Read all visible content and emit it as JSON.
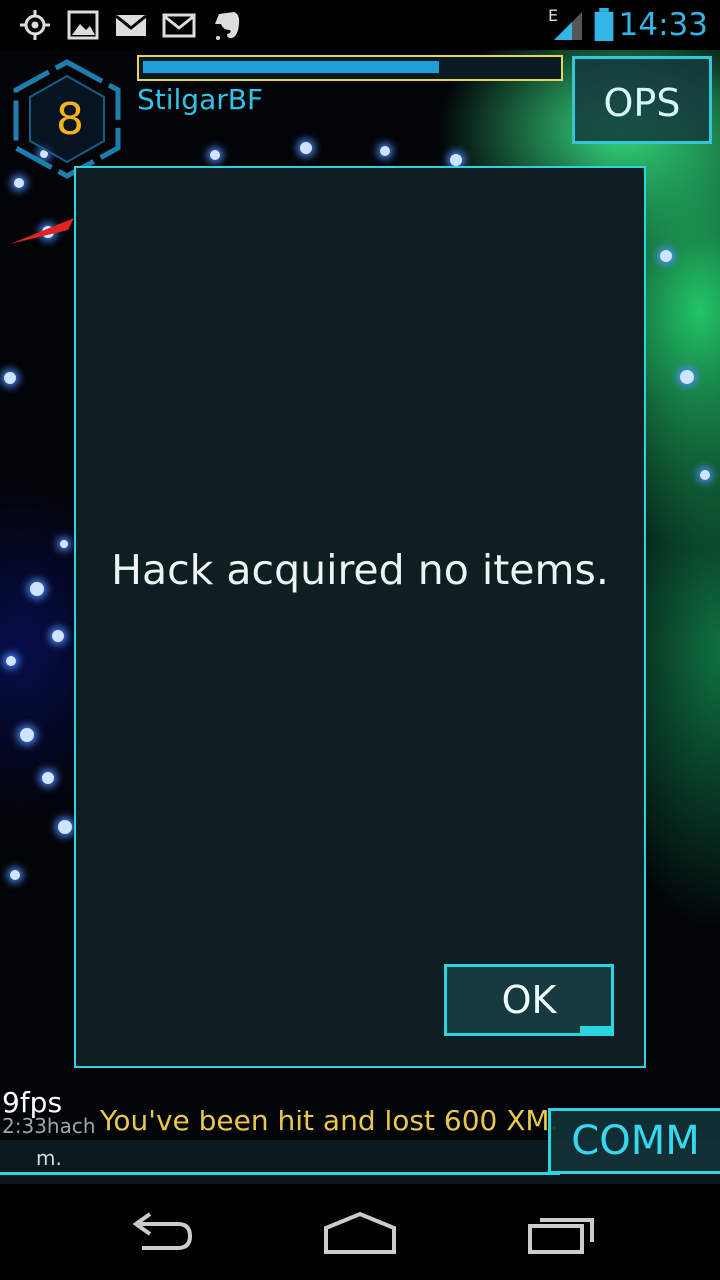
{
  "status_bar": {
    "time": "14:33",
    "network_type": "E",
    "icons": [
      "gps-icon",
      "gallery-icon",
      "gmail-icon",
      "gmail-icon",
      "evernote-icon",
      "signal-icon",
      "battery-icon"
    ]
  },
  "hud": {
    "level": "8",
    "agent_name": "StilgarBF",
    "xm_fill_fraction": 0.72,
    "ops_label": "OPS"
  },
  "dialog": {
    "message": "Hack acquired no items.",
    "ok_label": "OK"
  },
  "footer": {
    "fps": "9fps",
    "ticker_timestamp": "2:33hach",
    "ticker_message": "You've been hit and lost 600 XM.",
    "ticker_continuation": "m.",
    "comm_label": "COMM"
  },
  "navigation": {
    "buttons": [
      "back-icon",
      "home-icon",
      "recents-icon"
    ]
  },
  "colors": {
    "accent": "#2ad4e0",
    "level": "#f5b21a",
    "agent": "#2fc3e8",
    "ticker": "#e9c84a",
    "status": "#33b5e5"
  }
}
